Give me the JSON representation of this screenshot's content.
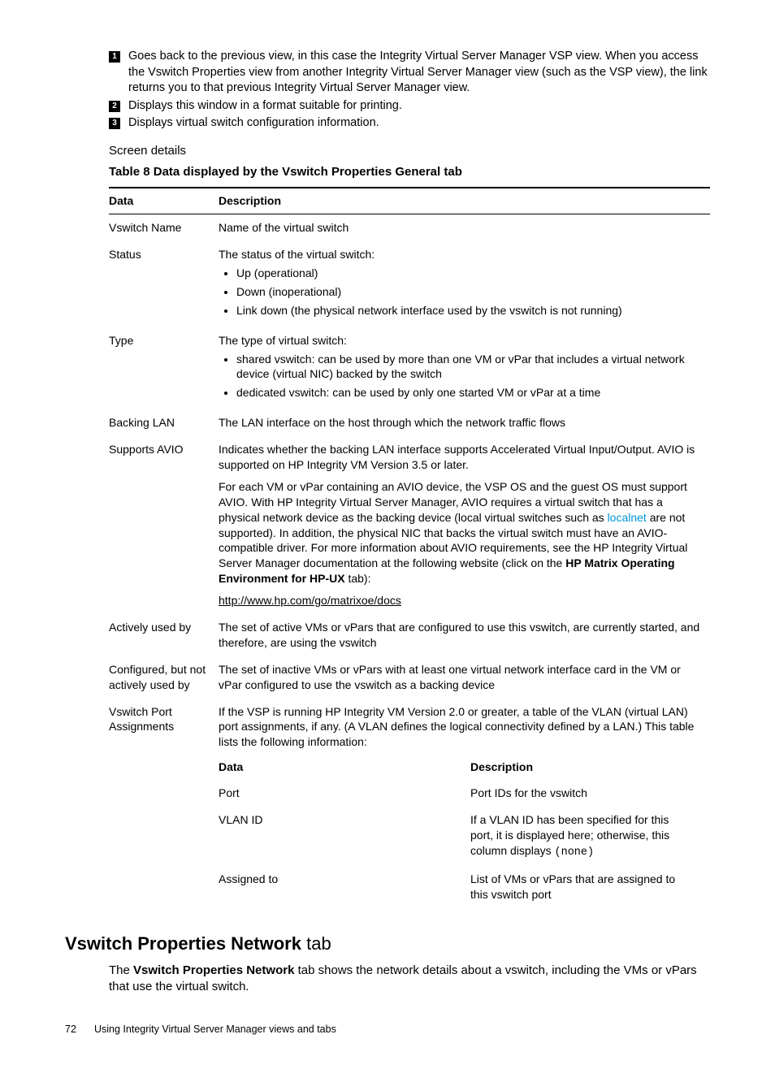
{
  "callouts": [
    {
      "num": "1",
      "text": "Goes back to the previous view, in this case the Integrity Virtual Server Manager VSP view. When you access the Vswitch Properties view from another Integrity Virtual Server Manager view (such as the VSP view), the link returns you to that previous Integrity Virtual Server Manager view."
    },
    {
      "num": "2",
      "text": "Displays this window in a format suitable for printing."
    },
    {
      "num": "3",
      "text": "Displays virtual switch configuration information."
    }
  ],
  "screen_details": "Screen details",
  "table_caption": "Table 8 Data displayed by the Vswitch Properties General tab",
  "headers": {
    "data": "Data",
    "description": "Description"
  },
  "rows": {
    "vswitch_name": {
      "data": "Vswitch Name",
      "desc": "Name of the virtual switch"
    },
    "status": {
      "data": "Status",
      "intro": "The status of the virtual switch:",
      "items": [
        "Up (operational)",
        "Down (inoperational)",
        "Link down (the physical network interface used by the vswitch is not running)"
      ]
    },
    "type": {
      "data": "Type",
      "intro": "The type of virtual switch:",
      "items": [
        "shared vswitch: can be used by more than one VM or vPar that includes a virtual network device (virtual NIC) backed by the switch",
        "dedicated vswitch: can be used by only one started VM or vPar at a time"
      ]
    },
    "backing_lan": {
      "data": "Backing LAN",
      "desc": "The LAN interface on the host through which the network traffic flows"
    },
    "supports_avio": {
      "data": "Supports AVIO",
      "p1": "Indicates whether the backing LAN interface supports Accelerated Virtual Input/Output. AVIO is supported on HP Integrity VM Version 3.5 or later.",
      "p2a": "For each VM or vPar containing an AVIO device, the VSP OS and the guest OS must support AVIO. With HP Integrity Virtual Server Manager, AVIO requires a virtual switch that has a physical network device as the backing device (local virtual switches such as ",
      "p2_link": "localnet",
      "p2b": " are not supported). In addition, the physical NIC that backs the virtual switch must have an AVIO-compatible driver. For more information about AVIO requirements, see the HP Integrity Virtual Server Manager documentation at the following website (click on the ",
      "p2_bold": "HP Matrix Operating Environment for HP-UX",
      "p2c": " tab):",
      "url": "http://www.hp.com/go/matrixoe/docs"
    },
    "actively_used": {
      "data": "Actively used by",
      "desc": "The set of active VMs or vPars that are configured to use this vswitch, are currently started, and therefore, are using the vswitch"
    },
    "configured_not": {
      "data": "Configured, but not actively used by",
      "desc": "The set of inactive VMs or vPars with at least one virtual network interface card in the VM or vPar configured to use the vswitch as a backing device"
    },
    "port_assign": {
      "data": "Vswitch Port Assignments",
      "intro": "If the VSP is running HP Integrity VM Version 2.0 or greater, a table of the VLAN (virtual LAN) port assignments, if any. (A VLAN defines the logical connectivity defined by a LAN.) This table lists the following information:",
      "inner_headers": {
        "data": "Data",
        "description": "Description"
      },
      "inner_rows": {
        "port": {
          "data": "Port",
          "desc": "Port IDs for the vswitch"
        },
        "vlan": {
          "data": "VLAN ID",
          "desc_a": "If a VLAN ID has been specified for this port, it is displayed here; otherwise, this column displays ",
          "desc_mono": "(none)"
        },
        "assigned": {
          "data": "Assigned to",
          "desc": "List of VMs or vPars that are assigned to this vswitch port"
        }
      }
    }
  },
  "section": {
    "title_bold": "Vswitch Properties Network",
    "title_rest": " tab",
    "body_a": "The ",
    "body_bold": "Vswitch Properties Network",
    "body_b": " tab shows the network details about a vswitch, including the VMs or vPars that use the virtual switch."
  },
  "footer": {
    "page": "72",
    "text": "Using Integrity Virtual Server Manager views and tabs"
  }
}
